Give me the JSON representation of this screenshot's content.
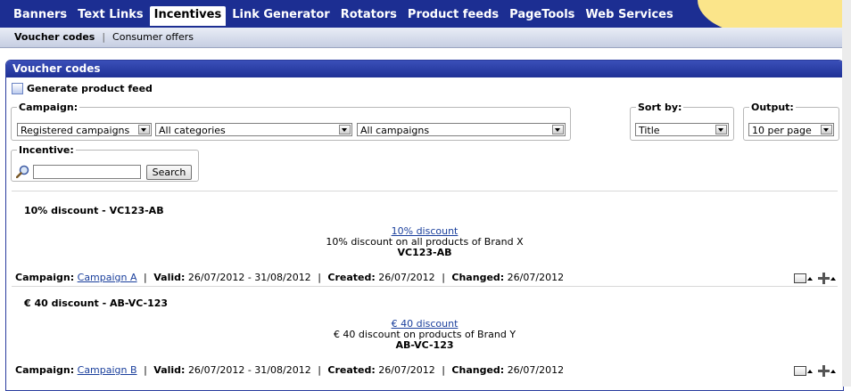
{
  "topnav": {
    "tabs": [
      {
        "label": "Banners",
        "active": false
      },
      {
        "label": "Text Links",
        "active": false
      },
      {
        "label": "Incentives",
        "active": true
      },
      {
        "label": "Link Generator",
        "active": false
      },
      {
        "label": "Rotators",
        "active": false
      },
      {
        "label": "Product feeds",
        "active": false
      },
      {
        "label": "PageTools",
        "active": false
      },
      {
        "label": "Web Services",
        "active": false
      }
    ]
  },
  "subnav": {
    "items": [
      "Voucher codes",
      "Consumer offers"
    ],
    "separator": "|"
  },
  "panel": {
    "title": "Voucher codes",
    "generate_feed_label": "Generate product feed"
  },
  "filters": {
    "campaign_legend": "Campaign:",
    "campaign_type": "Registered campaigns",
    "category": "All categories",
    "campaign": "All campaigns",
    "sort_legend": "Sort by:",
    "sort_value": "Title",
    "output_legend": "Output:",
    "output_value": "10 per page",
    "incentive_legend": "Incentive:",
    "search_button": "Search",
    "search_value": ""
  },
  "labels": {
    "campaign": "Campaign:",
    "valid": "Valid:",
    "created": "Created:",
    "changed": "Changed:",
    "pipe": "|"
  },
  "offers": [
    {
      "title": "10% discount - VC123-AB",
      "link": "10% discount",
      "description": "10% discount on all products of Brand X",
      "code": "VC123-AB",
      "campaign": "Campaign A",
      "valid": "26/07/2012 - 31/08/2012",
      "created": "26/07/2012",
      "changed": "26/07/2012"
    },
    {
      "title": "€ 40 discount - AB-VC-123",
      "link": "€ 40 discount",
      "description": "€ 40 discount on products of Brand Y",
      "code": "AB-VC-123",
      "campaign": "Campaign B",
      "valid": "26/07/2012 - 31/08/2012",
      "created": "26/07/2012",
      "changed": "26/07/2012"
    }
  ],
  "colors": {
    "nav_bg": "#1c2e92",
    "blob": "#fbe58a",
    "link": "#1a3f9c"
  }
}
